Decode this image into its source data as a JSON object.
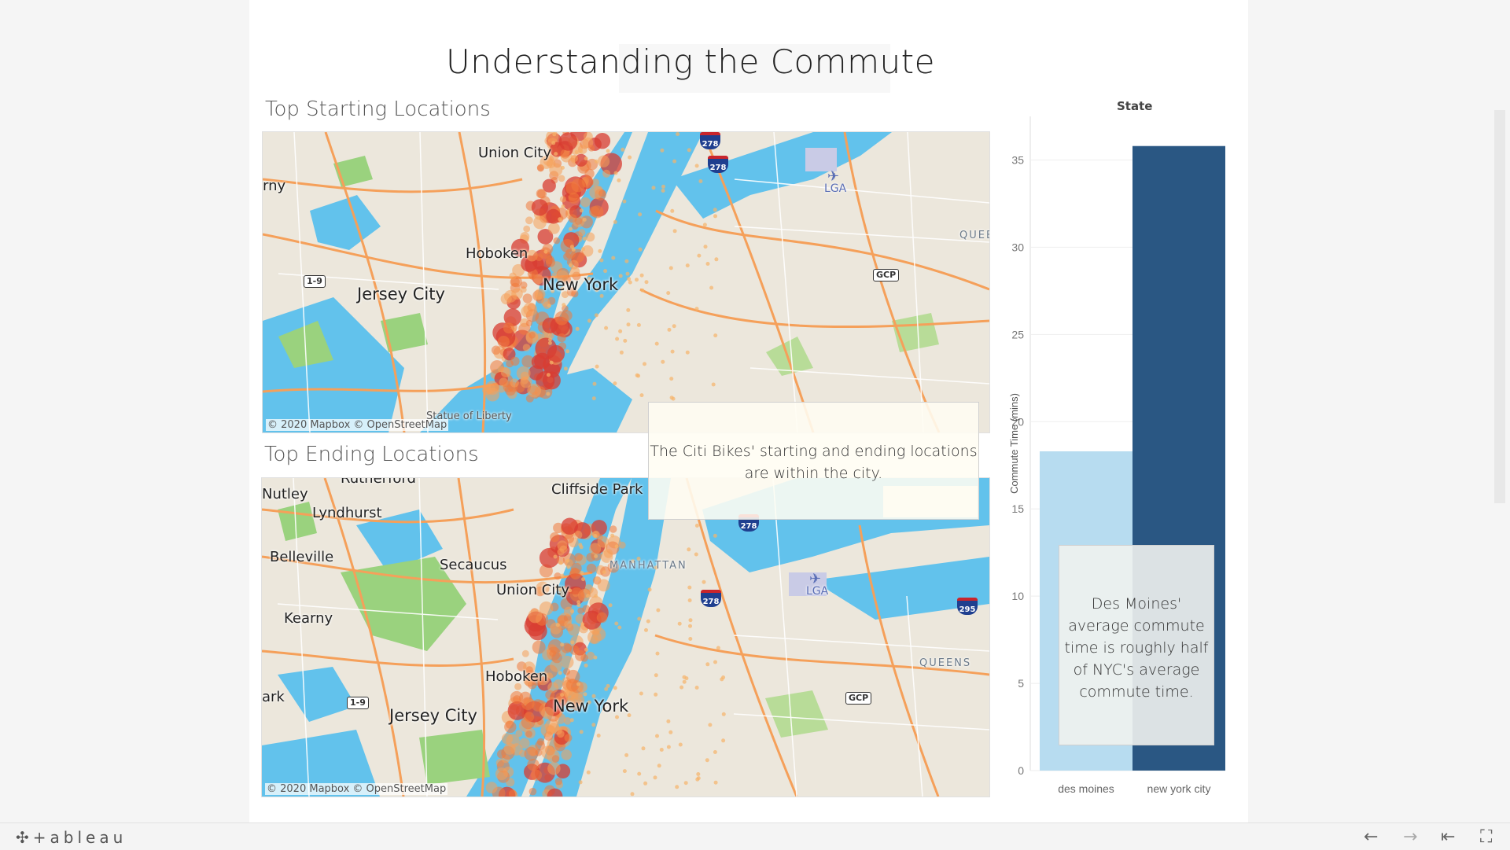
{
  "dashboard": {
    "title": "Understanding the Commute",
    "map_start": {
      "title": "Top Starting Locations",
      "credit": "© 2020 Mapbox  © OpenStreetMap",
      "labels": {
        "union_city": "Union City",
        "hoboken": "Hoboken",
        "jersey_city": "Jersey City",
        "new_york": "New York",
        "lga": "LGA",
        "statue": "Statue of Liberty",
        "queens": "QUEE",
        "left_edge": "rny",
        "i278_a": "278",
        "i278_b": "278",
        "gcp": "GCP",
        "r19": "1-9"
      }
    },
    "map_end": {
      "title": "Top Ending Locations",
      "credit": "© 2020 Mapbox  © OpenStreetMap",
      "labels": {
        "rutherford": "Rutherford",
        "nutley": "Nutley",
        "lyndhurst": "Lyndhurst",
        "belleville": "Belleville",
        "kearny": "Kearny",
        "secaucus": "Secaucus",
        "union_city": "Union City",
        "cliffside_park": "Cliffside Park",
        "manhattan": "MANHATTAN",
        "hoboken": "Hoboken",
        "jersey_city": "Jersey City",
        "new_york": "New York",
        "lga": "LGA",
        "queens": "QUEENS",
        "left_edge": "ark",
        "i278_a": "278",
        "i278_b": "278",
        "i295": "295",
        "gcp": "GCP",
        "r19": "1-9"
      }
    },
    "annotations": {
      "map_note": "The Citi Bikes' starting and ending locations are within the city.",
      "chart_note": "Des Moines' average commute time is roughly half of NYC's average commute time."
    }
  },
  "chart_data": {
    "type": "bar",
    "title": "State",
    "categories": [
      "des moines",
      "new york city"
    ],
    "values": [
      18.3,
      35.8
    ],
    "ylabel": "Commute Time (mins)",
    "xlabel": "",
    "ylim": [
      0,
      37.5
    ],
    "yticks": [
      0,
      5,
      10,
      15,
      20,
      25,
      30,
      35
    ],
    "colors": [
      "#b7dcf0",
      "#2a5783"
    ],
    "grid": true,
    "legend": "none"
  },
  "footer": {
    "logo": "+ableau",
    "logo_icon": "tableau-cross-icon",
    "buttons": [
      "undo-icon",
      "redo-icon",
      "revert-icon",
      "fullscreen-icon"
    ]
  }
}
